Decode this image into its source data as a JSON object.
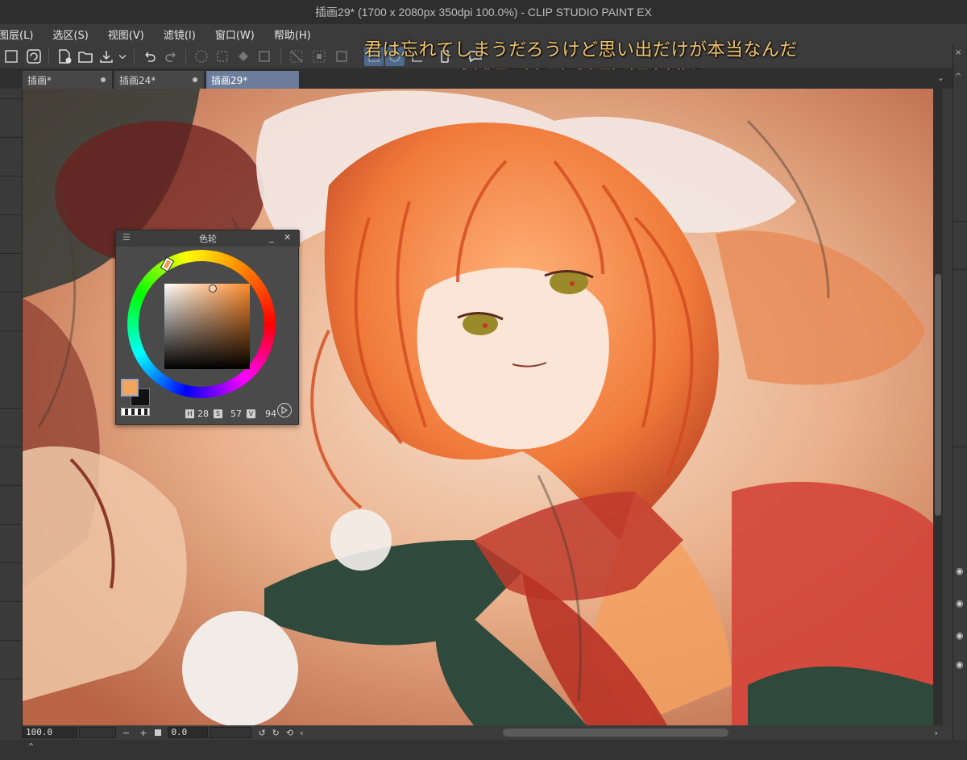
{
  "window": {
    "title": "插画29* (1700 x 2080px 350dpi 100.0%)  - CLIP STUDIO PAINT EX"
  },
  "menu": {
    "items": [
      "图层(L)",
      "选区(S)",
      "视图(V)",
      "滤镜(I)",
      "窗口(W)",
      "帮助(H)"
    ]
  },
  "subtitles": {
    "japanese": "君は忘れてしまうだろうけど思い出だけが本当なんだ",
    "chinese": "或许你早已忘却，但唯有回忆才是真实的啊"
  },
  "tabs": [
    {
      "label": "插画*"
    },
    {
      "label": "插画24*"
    },
    {
      "label": "插画29*",
      "active": true
    }
  ],
  "color_wheel": {
    "title": "色轮",
    "h_label": "H",
    "h_value": "28",
    "s_label": "S",
    "s_value": "57",
    "v_label": "V",
    "v_value": "94",
    "foreground_color": "#f2a55c",
    "background_color": "#111111"
  },
  "status": {
    "zoom_value": "100.0",
    "rotation_value": "0.0",
    "minus_label": "−",
    "plus_label": "+"
  },
  "colors": {
    "active_tab": "#6b7d99",
    "subtitle_jp": "#f2c36b",
    "subtitle_cn": "#f7d37e"
  }
}
